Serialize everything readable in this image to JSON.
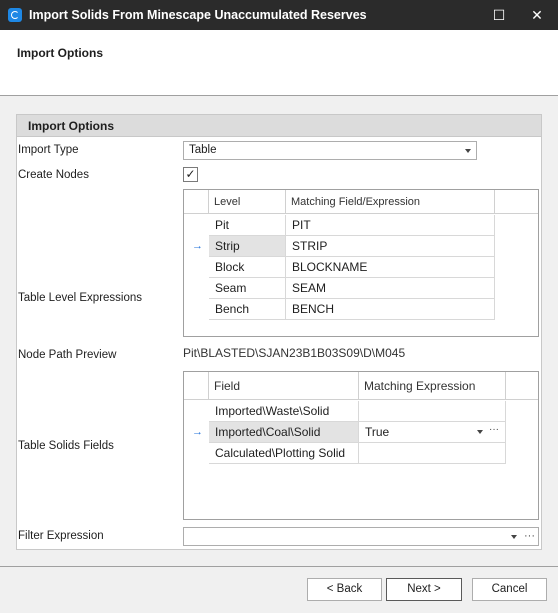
{
  "window": {
    "title": "Import Solids From Minescape Unaccumulated Reserves",
    "maximize_glyph": "☐",
    "close_glyph": "✕"
  },
  "header": {
    "title": "Import Options"
  },
  "group": {
    "title": "Import Options"
  },
  "fields": {
    "import_type_label": "Import Type",
    "import_type_value": "Table",
    "create_nodes_label": "Create Nodes",
    "create_nodes_checked": "✓",
    "table_level_label": "Table Level Expressions",
    "node_path_label": "Node Path Preview",
    "node_path_value": "Pit\\BLASTED\\SJAN23B1B03S09\\D\\M045",
    "table_solids_label": "Table Solids Fields",
    "filter_label": "Filter Expression",
    "filter_value": ""
  },
  "level_grid": {
    "columns": [
      "Level",
      "Matching Field/Expression"
    ],
    "indicator": "→",
    "rows": [
      {
        "level": "Pit",
        "expr": "PIT"
      },
      {
        "level": "Strip",
        "expr": "STRIP"
      },
      {
        "level": "Block",
        "expr": "BLOCKNAME"
      },
      {
        "level": "Seam",
        "expr": "SEAM"
      },
      {
        "level": "Bench",
        "expr": "BENCH"
      }
    ]
  },
  "solids_grid": {
    "columns": [
      "Field",
      "Matching Expression"
    ],
    "indicator": "→",
    "ellipsis": "···",
    "rows": [
      {
        "field": "Imported\\Waste\\Solid",
        "expr": ""
      },
      {
        "field": "Imported\\Coal\\Solid",
        "expr": "True"
      },
      {
        "field": "Calculated\\Plotting Solid",
        "expr": ""
      }
    ]
  },
  "buttons": {
    "back": "< Back",
    "next": "Next >",
    "cancel": "Cancel"
  },
  "colors": {
    "titlebar": "#2b2b2b",
    "accent": "#1e88e5",
    "row_indicator": "#1e6fd9"
  }
}
